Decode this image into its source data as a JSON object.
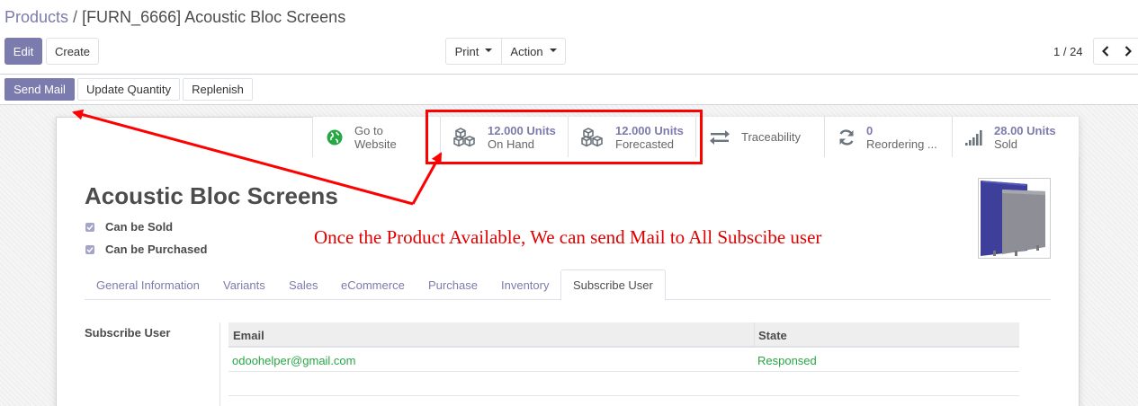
{
  "breadcrumb": {
    "parent": "Products",
    "separator": "/",
    "current": "[FURN_6666] Acoustic Bloc Screens"
  },
  "toolbar": {
    "edit": "Edit",
    "create": "Create",
    "print": "Print",
    "action": "Action"
  },
  "pager": {
    "value": "1 / 24"
  },
  "statusbar": {
    "send_mail": "Send Mail",
    "update_quantity": "Update Quantity",
    "replenish": "Replenish"
  },
  "smart_buttons": [
    {
      "value": "Go to",
      "label": "Website",
      "icon": "globe-icon"
    },
    {
      "value": "12.000 Units",
      "label": "On Hand",
      "icon": "cubes-icon"
    },
    {
      "value": "12.000 Units",
      "label": "Forecasted",
      "icon": "cubes-icon"
    },
    {
      "value": "",
      "label": "Traceability",
      "icon": "exchange-icon"
    },
    {
      "value": "0",
      "label": "Reordering ...",
      "icon": "refresh-icon"
    },
    {
      "value": "28.00 Units",
      "label": "Sold",
      "icon": "signal-icon"
    }
  ],
  "product": {
    "name": "Acoustic Bloc Screens",
    "can_be_sold": "Can be Sold",
    "can_be_purchased": "Can be Purchased"
  },
  "annotation": {
    "text": "Once the Product Available, We can send Mail to All Subscibe user",
    "color": "#e00000"
  },
  "tabs": [
    "General Information",
    "Variants",
    "Sales",
    "eCommerce",
    "Purchase",
    "Inventory",
    "Subscribe User"
  ],
  "active_tab": "Subscribe User",
  "subscribe": {
    "section_label": "Subscribe User",
    "columns": {
      "email": "Email",
      "state": "State"
    },
    "rows": [
      {
        "email": "odoohelper@gmail.com",
        "state": "Responsed"
      }
    ]
  },
  "colors": {
    "primary": "#7c7bad",
    "accent_text": "#7c7bad",
    "success": "#28a745",
    "annotation": "#e00000"
  }
}
